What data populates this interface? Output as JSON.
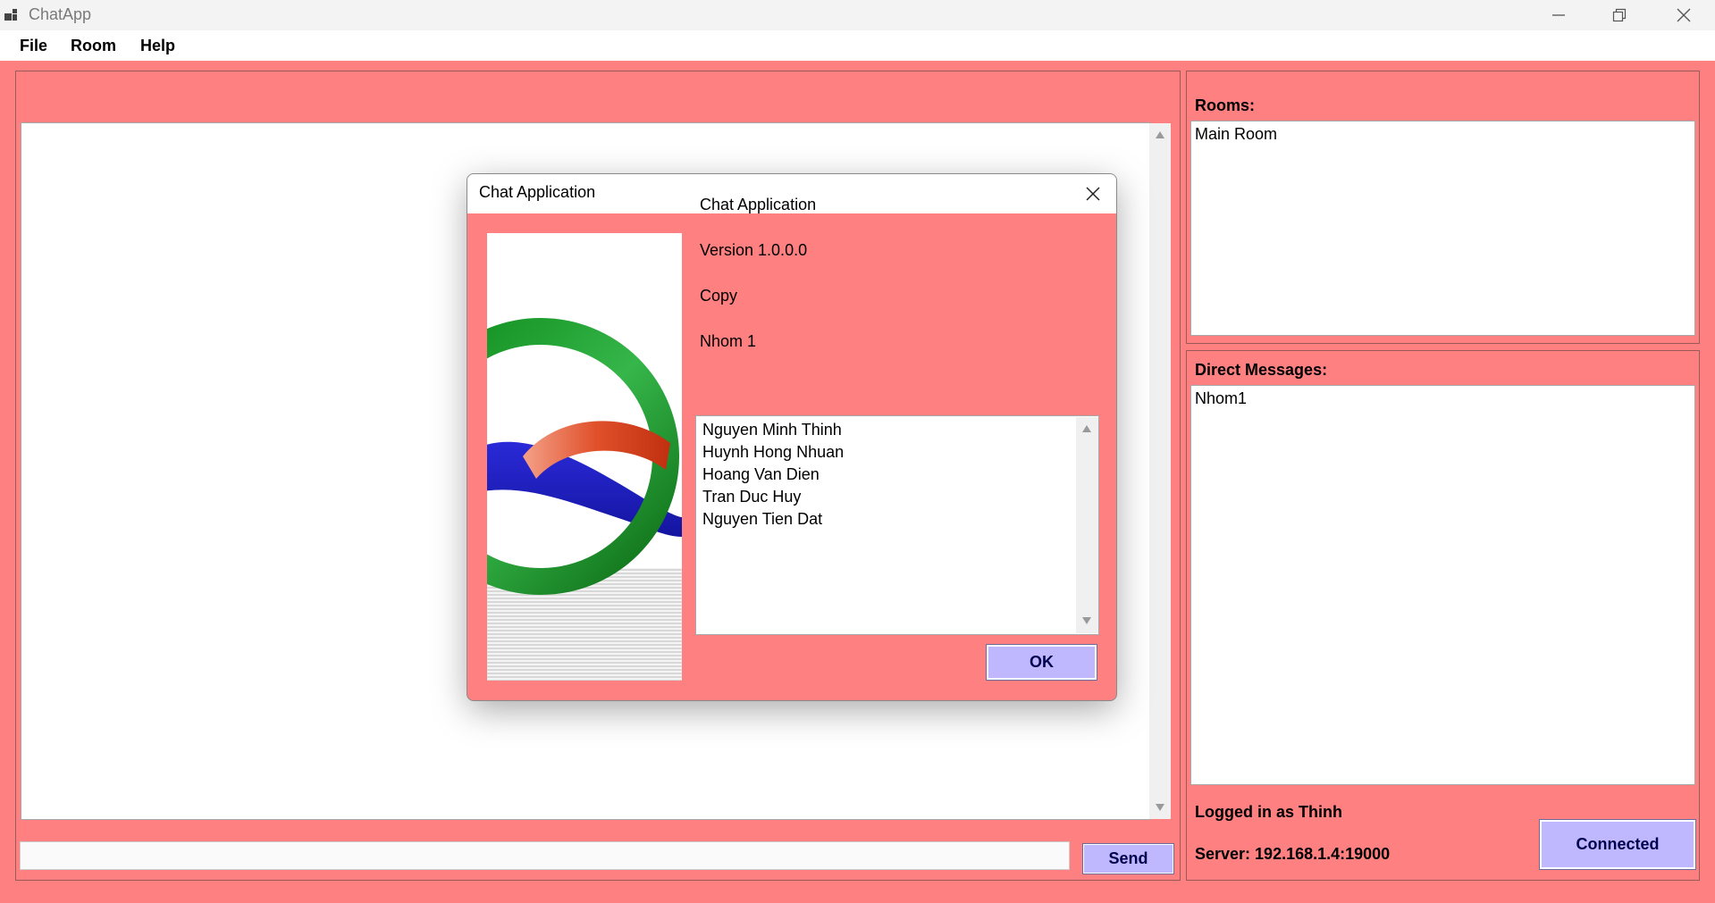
{
  "window": {
    "title": "ChatApp",
    "icon": "app-windows-icon",
    "controls": [
      "minimize-icon",
      "restore-icon",
      "close-icon"
    ]
  },
  "menu": {
    "items": [
      {
        "label": "File"
      },
      {
        "label": "Room"
      },
      {
        "label": "Help"
      }
    ]
  },
  "chat": {
    "input_value": "",
    "send_label": "Send"
  },
  "rooms": {
    "title": "Rooms:",
    "items": [
      "Main Room"
    ]
  },
  "direct_messages": {
    "title": "Direct Messages:",
    "items": [
      "Nhom1"
    ]
  },
  "status": {
    "logged_in": "Logged in as Thinh",
    "server": "Server: 192.168.1.4:19000",
    "connect_label": "Connected"
  },
  "about_dialog": {
    "title": "Chat Application",
    "product_name": "Chat Application",
    "version": "Version 1.0.0.0",
    "copyright": "Copy",
    "company": "Nhom 1",
    "credits": [
      "Nguyen Minh Thinh",
      "Huynh Hong Nhuan",
      "Hoang Van Dien",
      "Tran Duc Huy",
      "Nguyen Tien Dat"
    ],
    "ok_label": "OK"
  },
  "colors": {
    "background": "#ff8080",
    "button": "#c0b8ff",
    "button_text": "#000050"
  }
}
